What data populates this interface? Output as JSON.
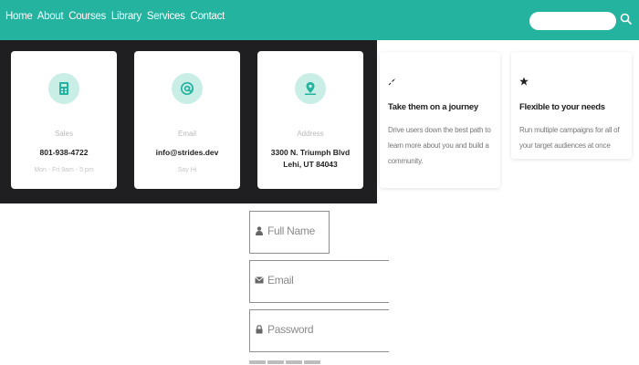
{
  "nav": {
    "links": [
      "Home",
      "About",
      "Courses",
      "Library",
      "Services",
      "Contact"
    ],
    "search_placeholder": ""
  },
  "contacts": [
    {
      "icon": "calculator-icon",
      "label": "Sales",
      "value": "801-938-4722",
      "value2": "",
      "sub": "Mon - Fri 9am - 5 pm"
    },
    {
      "icon": "at-sign-icon",
      "label": "Email",
      "value": "info@strides.dev",
      "value2": "",
      "sub": "Say Hi"
    },
    {
      "icon": "map-pin-icon",
      "label": "Address",
      "value": "3300 N. Triumph Blvd",
      "value2": "Lehi, UT 84043",
      "sub": ""
    }
  ],
  "features": [
    {
      "icon": "rocket-icon",
      "title": "Take them on a journey",
      "desc": "Drive users down the best path to learn more about you and build a community."
    },
    {
      "icon": "star-icon",
      "title": "Flexible to your needs",
      "desc": "Run multiple campaigns for all of your target audiences at once"
    }
  ],
  "form": {
    "full_name_placeholder": "Full Name",
    "email_placeholder": "Email",
    "password_placeholder": "Password"
  },
  "colors": {
    "accent": "#23b39f",
    "panel": "#1f1f22"
  }
}
